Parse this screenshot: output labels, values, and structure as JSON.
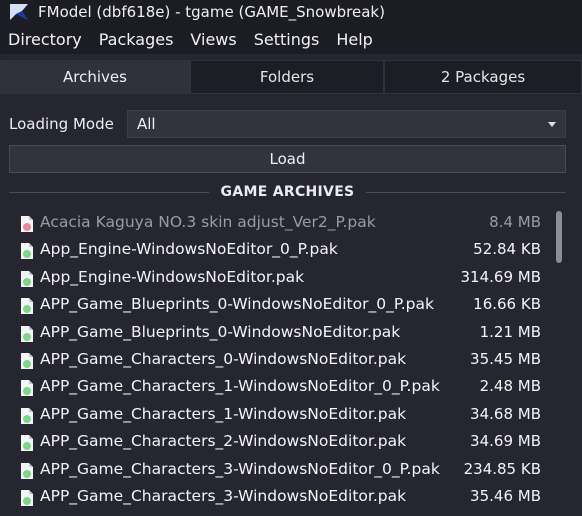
{
  "window": {
    "title": "FModel (dbf618e) - tgame (GAME_Snowbreak)"
  },
  "menu": [
    {
      "label": "Directory"
    },
    {
      "label": "Packages"
    },
    {
      "label": "Views"
    },
    {
      "label": "Settings"
    },
    {
      "label": "Help"
    }
  ],
  "tabs": [
    {
      "label": "Archives",
      "active": true
    },
    {
      "label": "Folders",
      "active": false
    },
    {
      "label": "2 Packages",
      "active": false
    }
  ],
  "loading_mode": {
    "label": "Loading Mode",
    "value": "All"
  },
  "load_button": {
    "label": "Load"
  },
  "section": {
    "title": "GAME ARCHIVES"
  },
  "colors": {
    "accent_green": "#7ed68a",
    "accent_pink": "#e8889a",
    "background": "#25262f"
  },
  "files": [
    {
      "name": "Acacia Kaguya NO.3 skin adjust_Ver2_P.pak",
      "size": "8.4 MB",
      "icon": "pak-file-pink-icon",
      "enabled": false
    },
    {
      "name": "App_Engine-WindowsNoEditor_0_P.pak",
      "size": "52.84 KB",
      "icon": "pak-file-green-icon",
      "enabled": true
    },
    {
      "name": "App_Engine-WindowsNoEditor.pak",
      "size": "314.69 MB",
      "icon": "pak-file-green-icon",
      "enabled": true
    },
    {
      "name": "APP_Game_Blueprints_0-WindowsNoEditor_0_P.pak",
      "size": "16.66 KB",
      "icon": "pak-file-green-icon",
      "enabled": true
    },
    {
      "name": "APP_Game_Blueprints_0-WindowsNoEditor.pak",
      "size": "1.21 MB",
      "icon": "pak-file-green-icon",
      "enabled": true
    },
    {
      "name": "APP_Game_Characters_0-WindowsNoEditor.pak",
      "size": "35.45 MB",
      "icon": "pak-file-green-icon",
      "enabled": true
    },
    {
      "name": "APP_Game_Characters_1-WindowsNoEditor_0_P.pak",
      "size": "2.48 MB",
      "icon": "pak-file-green-icon",
      "enabled": true
    },
    {
      "name": "APP_Game_Characters_1-WindowsNoEditor.pak",
      "size": "34.68 MB",
      "icon": "pak-file-green-icon",
      "enabled": true
    },
    {
      "name": "APP_Game_Characters_2-WindowsNoEditor.pak",
      "size": "34.69 MB",
      "icon": "pak-file-green-icon",
      "enabled": true
    },
    {
      "name": "APP_Game_Characters_3-WindowsNoEditor_0_P.pak",
      "size": "234.85 KB",
      "icon": "pak-file-green-icon",
      "enabled": true
    },
    {
      "name": "APP_Game_Characters_3-WindowsNoEditor.pak",
      "size": "35.46 MB",
      "icon": "pak-file-green-icon",
      "enabled": true
    }
  ]
}
